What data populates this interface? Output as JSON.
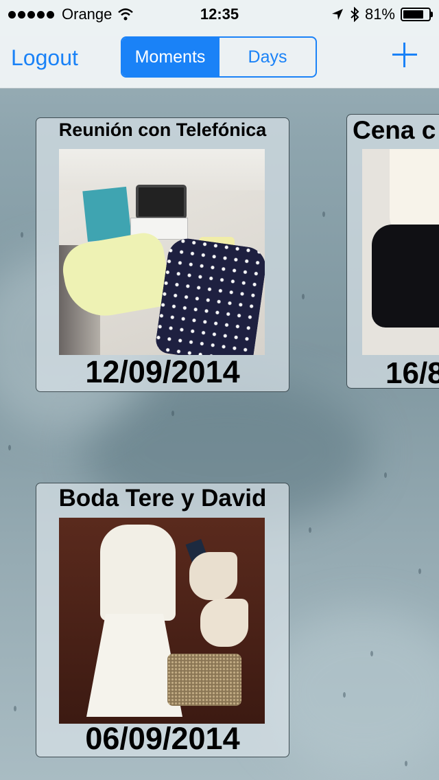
{
  "status_bar": {
    "carrier": "Orange",
    "time": "12:35",
    "battery_percent": "81%",
    "battery_level": 0.81,
    "signal_bars": 5,
    "icons": [
      "wifi-icon",
      "location-arrow-icon",
      "bluetooth-icon",
      "battery-icon"
    ]
  },
  "nav": {
    "logout_label": "Logout",
    "segments": [
      {
        "label": "Moments",
        "selected": true
      },
      {
        "label": "Days",
        "selected": false
      }
    ],
    "add_icon": "plus-icon"
  },
  "colors": {
    "accent": "#1a82f7"
  },
  "moments": [
    {
      "title": "Reunión con Telefónica",
      "date": "12/09/2014",
      "photo": "outfit-photo"
    },
    {
      "title": "Cena c",
      "date": "16/8",
      "photo": "outfit-photo"
    },
    {
      "title": "Boda Tere y David",
      "date": "06/09/2014",
      "photo": "outfit-photo"
    }
  ]
}
